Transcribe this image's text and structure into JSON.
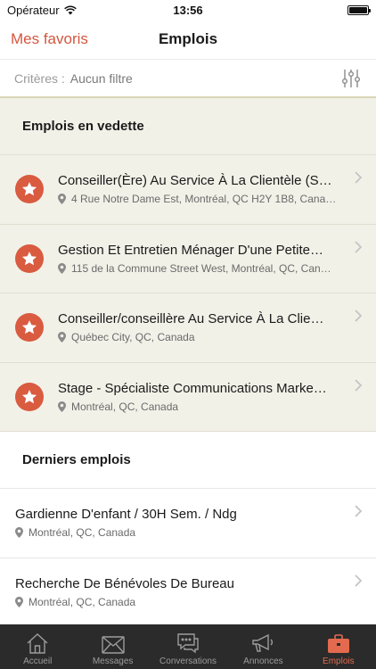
{
  "status_bar": {
    "carrier": "Opérateur",
    "time": "13:56"
  },
  "nav": {
    "back_label": "Mes favoris",
    "title": "Emplois"
  },
  "filter": {
    "label": "Critères :",
    "value": "Aucun filtre"
  },
  "featured": {
    "header": "Emplois en vedette",
    "jobs": [
      {
        "title": "Conseiller(Ère) Au Service À La Clientèle (S…",
        "location": "4 Rue Notre Dame Est, Montréal, QC H2Y 1B8, Cana…"
      },
      {
        "title": "Gestion Et Entretien Ménager D'une Petite…",
        "location": "115 de la Commune Street West, Montréal, QC, Can…"
      },
      {
        "title": "Conseiller/conseillère Au Service À La Clie…",
        "location": "Québec City, QC, Canada"
      },
      {
        "title": "Stage - Spécialiste Communications Marke…",
        "location": "Montréal, QC, Canada"
      }
    ]
  },
  "latest": {
    "header": "Derniers emplois",
    "jobs": [
      {
        "title": "Gardienne D'enfant / 30H Sem. / Ndg",
        "location": "Montréal, QC, Canada"
      },
      {
        "title": "Recherche De Bénévoles De Bureau",
        "location": "Montréal, QC, Canada"
      }
    ]
  },
  "tabs": [
    {
      "label": "Accueil",
      "icon": "home-icon"
    },
    {
      "label": "Messages",
      "icon": "envelope-icon"
    },
    {
      "label": "Conversations",
      "icon": "chat-bubbles-icon"
    },
    {
      "label": "Annonces",
      "icon": "megaphone-icon"
    },
    {
      "label": "Emplois",
      "icon": "briefcase-icon",
      "active": true
    }
  ],
  "colors": {
    "accent": "#d4563f",
    "featured_bg": "#f2f1e8",
    "tab_bar_bg": "#2b2b2b",
    "tab_active": "#e36a4e"
  }
}
